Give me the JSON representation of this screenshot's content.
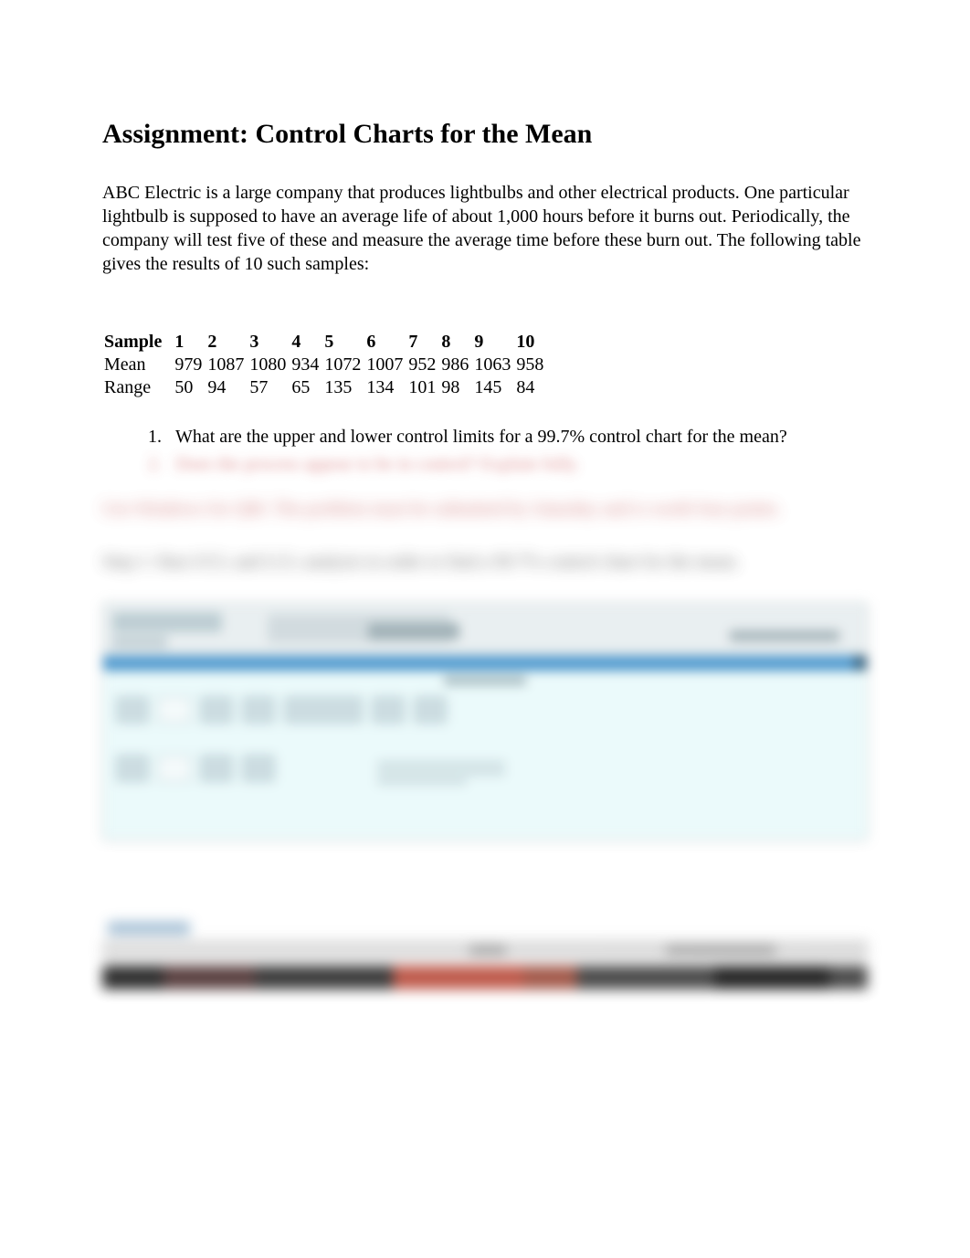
{
  "title": "Assignment: Control Charts for the Mean",
  "intro": "ABC Electric is a large company that produces lightbulbs and other electrical products. One particular lightbulb is supposed to have an average life of about 1,000 hours before it burns out. Periodically, the company will test five of these and measure the average time before these burn out. The following table gives the results of 10 such samples:",
  "table": {
    "header_label": "Sample",
    "columns": [
      "1",
      "2",
      "3",
      "4",
      "5",
      "6",
      "7",
      "8",
      "9",
      "10"
    ],
    "rows": [
      {
        "label": "Mean",
        "values": [
          "979",
          "1087",
          "1080",
          "934",
          "1072",
          "1007",
          "952",
          "986",
          "1063",
          "958"
        ]
      },
      {
        "label": "Range",
        "values": [
          "50",
          "94",
          "57",
          "65",
          "135",
          "134",
          "101",
          "98",
          "145",
          "84"
        ]
      }
    ]
  },
  "questions": [
    "What are the upper and lower control limits for a 99.7% control chart for the mean?",
    "Does the process appear to be in control? Explain fully."
  ],
  "blurred": {
    "submit_note": "Use Windows for QM. The problem must be submitted by Saturday and is worth four points.",
    "step_note": "Step 1: Run UCL and LCL analysis in order to find a 99.7% control chart for the mean."
  },
  "chart_data": {
    "type": "table",
    "title": "Sample data",
    "columns": [
      "Sample",
      "1",
      "2",
      "3",
      "4",
      "5",
      "6",
      "7",
      "8",
      "9",
      "10"
    ],
    "rows": [
      [
        "Mean",
        979,
        1087,
        1080,
        934,
        1072,
        1007,
        952,
        986,
        1063,
        958
      ],
      [
        "Range",
        50,
        94,
        57,
        65,
        135,
        134,
        101,
        98,
        145,
        84
      ]
    ]
  }
}
